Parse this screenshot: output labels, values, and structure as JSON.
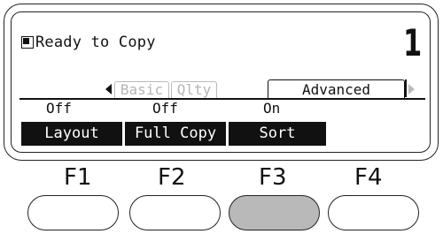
{
  "screen": {
    "status_text": "Ready to Copy",
    "copies": "1",
    "tabs": [
      {
        "label": "Basic",
        "state": "inactive"
      },
      {
        "label": "Qlty",
        "state": "inactive"
      },
      {
        "label": "Advanced",
        "state": "active"
      }
    ],
    "values": [
      "Off",
      "Off",
      "On"
    ],
    "function_labels": [
      "Layout",
      "Full Copy",
      "Sort"
    ]
  },
  "buttons": [
    {
      "label": "F1",
      "pressed": false
    },
    {
      "label": "F2",
      "pressed": false
    },
    {
      "label": "F3",
      "pressed": true
    },
    {
      "label": "F4",
      "pressed": false
    }
  ],
  "colors": {
    "ink": "#111111",
    "pressed": "#b9b9b9",
    "inactive_tab": "#b5b5b5"
  },
  "icons": {
    "status": "copy-document-icon",
    "tab_left": "left-triangle-icon",
    "tab_right": "right-triangle-icon"
  }
}
